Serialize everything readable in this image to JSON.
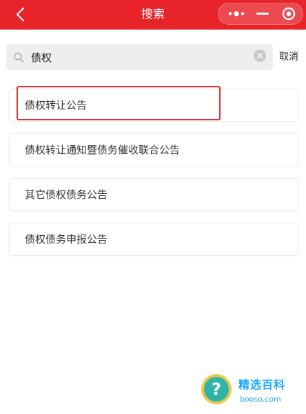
{
  "header": {
    "title": "搜索",
    "back_icon": "chevron-left-icon",
    "more_icon": "more-dots-icon",
    "minimize_icon": "minus-icon",
    "close_icon": "target-close-icon",
    "bg_color": "#e8232a"
  },
  "search": {
    "value": "债权",
    "placeholder": "",
    "cancel_label": "取消"
  },
  "results": [
    {
      "label": "债权转让公告"
    },
    {
      "label": "债权转让通知暨债务催收联合公告"
    },
    {
      "label": "其它债权债务公告"
    },
    {
      "label": "债权债务申报公告"
    }
  ],
  "watermark": {
    "glyph": "?",
    "brand": "精选百科",
    "url": "booso.com"
  }
}
